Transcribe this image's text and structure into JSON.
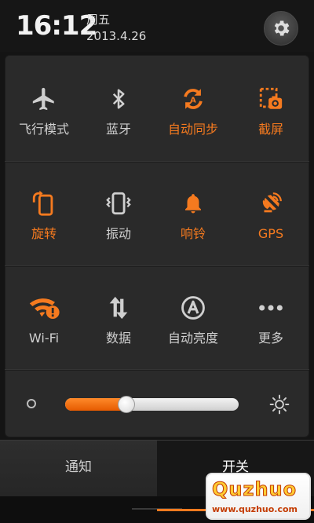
{
  "status": {
    "time": "16:12",
    "weekday": "周五",
    "date": "2013.4.26"
  },
  "colors": {
    "accent": "#f57a1f",
    "inactive": "#cfcfcf",
    "panel": "#2a2a2a"
  },
  "toggles": [
    {
      "label": "飞行模式",
      "icon": "airplane-icon",
      "active": false
    },
    {
      "label": "蓝牙",
      "icon": "bluetooth-icon",
      "active": false
    },
    {
      "label": "自动同步",
      "icon": "sync-icon",
      "active": true
    },
    {
      "label": "截屏",
      "icon": "screenshot-icon",
      "active": true
    },
    {
      "label": "旋转",
      "icon": "rotate-icon",
      "active": true
    },
    {
      "label": "振动",
      "icon": "vibrate-icon",
      "active": false
    },
    {
      "label": "响铃",
      "icon": "bell-icon",
      "active": true
    },
    {
      "label": "GPS",
      "icon": "gps-icon",
      "active": true
    },
    {
      "label": "Wi-Fi",
      "icon": "wifi-icon",
      "active": true
    },
    {
      "label": "数据",
      "icon": "data-icon",
      "active": false
    },
    {
      "label": "自动亮度",
      "icon": "auto-brightness-icon",
      "active": false
    },
    {
      "label": "更多",
      "icon": "more-icon",
      "active": false
    }
  ],
  "brightness": {
    "level": 0.35
  },
  "tabs": {
    "notifications": "通知",
    "toggles": "开关",
    "selected": "toggles"
  },
  "watermark": {
    "logo": "Quzhuo",
    "url": "www.quzhuo.com"
  }
}
